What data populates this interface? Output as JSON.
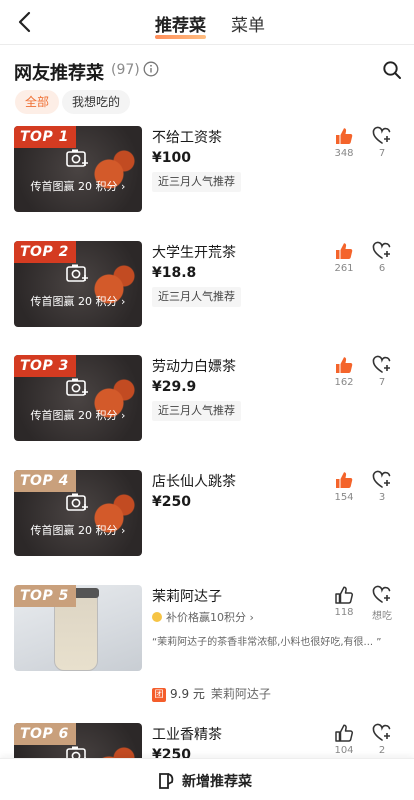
{
  "header": {
    "tabs": [
      {
        "label": "推荐菜"
      },
      {
        "label": "菜单"
      }
    ]
  },
  "section": {
    "title": "网友推荐菜",
    "count": "(97)"
  },
  "filters": [
    {
      "label": "全部"
    },
    {
      "label": "我想吃的"
    }
  ],
  "upload_text": "传首图赢 20 积分 ›",
  "items": [
    {
      "rank": "TOP 1",
      "name": "不给工资茶",
      "price": "¥100",
      "tag": "近三月人气推荐",
      "likes": "348",
      "wants": "7"
    },
    {
      "rank": "TOP 2",
      "name": "大学生开荒茶",
      "price": "¥18.8",
      "tag": "近三月人气推荐",
      "likes": "261",
      "wants": "6"
    },
    {
      "rank": "TOP 3",
      "name": "劳动力白嫖茶",
      "price": "¥29.9",
      "tag": "近三月人气推荐",
      "likes": "162",
      "wants": "7"
    },
    {
      "rank": "TOP 4",
      "name": "店长仙人跳茶",
      "price": "¥250",
      "likes": "154",
      "wants": "3"
    },
    {
      "rank": "TOP 5",
      "name": "茉莉阿达子",
      "coin_text": "补价格赢10积分 ›",
      "quote": "“茉莉阿达子的茶香非常浓郁,小料也很好吃,有很... ”",
      "likes": "118",
      "wants": "想吃",
      "group_badge": "团",
      "group_price": "9.9 元",
      "group_name": "茉莉阿达子"
    },
    {
      "rank": "TOP 6",
      "name": "工业香精茶",
      "price": "¥250",
      "likes": "104",
      "wants": "2"
    }
  ],
  "bottom": {
    "add_label": "新增推荐菜"
  },
  "colors": {
    "accent": "#ef6f33",
    "badge_top": "#d43b21",
    "badge_low": "#c9a07c",
    "like_active": "#f4642b"
  }
}
